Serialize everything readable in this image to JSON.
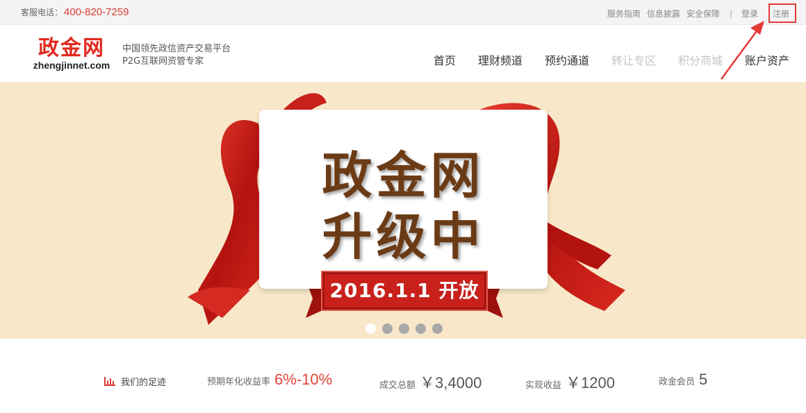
{
  "topbar": {
    "phone_label": "客服电话：",
    "phone_number": "400-820-7259",
    "links": [
      "服务指南",
      "信息披露",
      "安全保障"
    ],
    "separator": "|",
    "login": "登录",
    "register": "注册"
  },
  "header": {
    "logo_cn": "政金网",
    "logo_en": "zhengjinnet.com",
    "slogan_line1": "中国领先政信资产交易平台",
    "slogan_line2": "P2G互联网资管专家",
    "nav": [
      {
        "label": "首页",
        "enabled": true
      },
      {
        "label": "理财频道",
        "enabled": true
      },
      {
        "label": "预约通道",
        "enabled": true
      },
      {
        "label": "转让专区",
        "enabled": false
      },
      {
        "label": "积分商城",
        "enabled": false
      },
      {
        "label": "账户资产",
        "enabled": true
      }
    ]
  },
  "banner": {
    "title_line1": "政金网",
    "title_line2": "升级中",
    "open_text": "2016.1.1 开放",
    "slide_count": 5,
    "active_slide": 1
  },
  "stats": {
    "footprint_label": "我们的足迹",
    "annual_yield_label": "预期年化收益率",
    "annual_yield_value": "6%-10%",
    "total_deals_label": "成交总额",
    "total_deals_value": "￥3,4000",
    "realized_income_label": "实现收益",
    "realized_income_value": "￥1200",
    "members_label": "政金会员",
    "members_value": "5"
  },
  "colors": {
    "brand_red": "#e02b1f",
    "banner_bg": "#f8e8c9",
    "title_brown": "#6b3b16",
    "highlight_red": "#e53935"
  }
}
